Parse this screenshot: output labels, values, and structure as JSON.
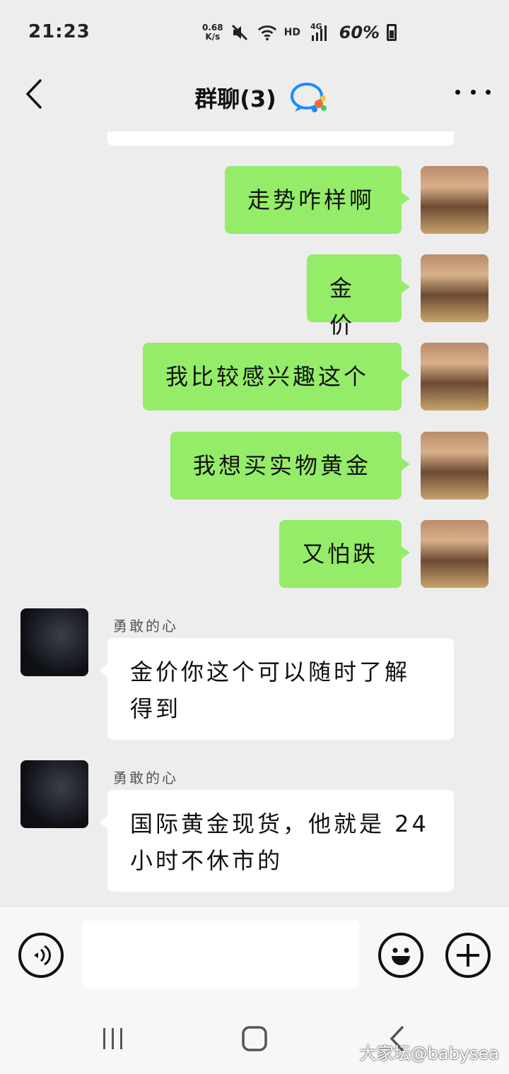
{
  "status_bar": {
    "time": "21:23",
    "net_speed_value": "0.68",
    "net_speed_unit": "K/s",
    "hd_label": "HD",
    "network_label": "4G",
    "battery_percent": "60%"
  },
  "header": {
    "title": "群聊(3)"
  },
  "messages": [
    {
      "sender": "me",
      "text": "走势咋样啊"
    },
    {
      "sender": "me",
      "text": "金价"
    },
    {
      "sender": "me",
      "text": "我比较感兴趣这个"
    },
    {
      "sender": "me",
      "text": "我想买实物黄金"
    },
    {
      "sender": "me",
      "text": "又怕跌"
    },
    {
      "sender": "other",
      "name": "勇敢的心",
      "text": "金价你这个可以随时了解得到"
    },
    {
      "sender": "other",
      "name": "勇敢的心",
      "text": "国际黄金现货，他就是 24 小时不休市的"
    }
  ],
  "input": {
    "value": "",
    "placeholder": ""
  },
  "icons": {
    "back": "chevron-left-icon",
    "chat_bubble": "chat-bubble-icon",
    "more": "more-dots-icon",
    "voice": "voice-icon",
    "emoji": "emoji-icon",
    "plus": "plus-icon"
  },
  "colors": {
    "background": "#ededed",
    "my_bubble": "#95ec69",
    "other_bubble": "#ffffff"
  },
  "watermark": "大家坛@babysea"
}
